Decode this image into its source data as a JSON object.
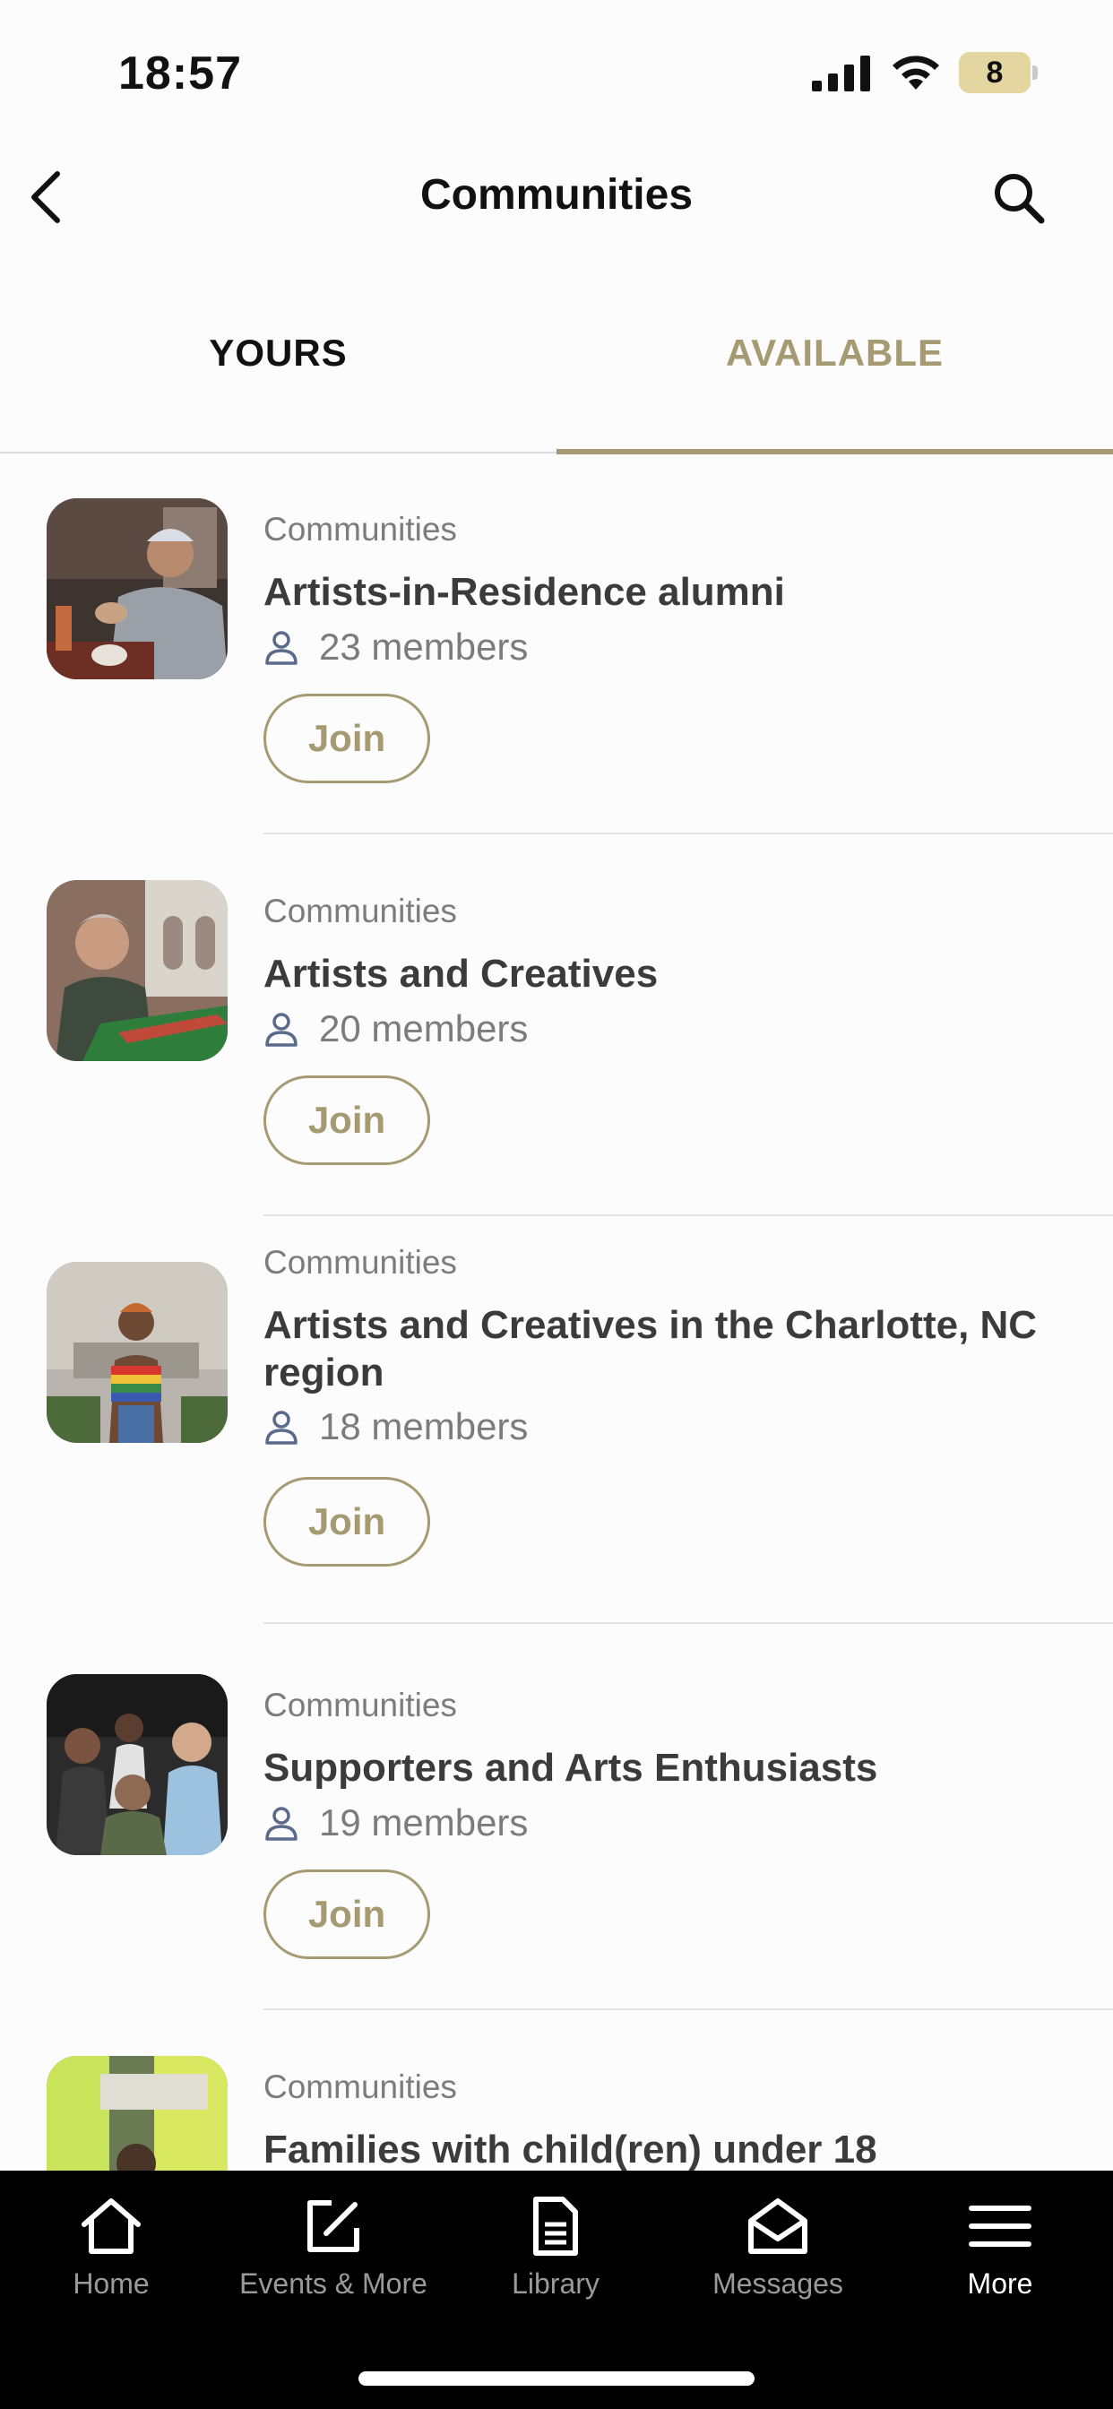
{
  "status_bar": {
    "time": "18:57",
    "battery": "8"
  },
  "header": {
    "title": "Communities"
  },
  "tabs": [
    {
      "label": "YOURS",
      "active": false
    },
    {
      "label": "AVAILABLE",
      "active": true
    }
  ],
  "communities": [
    {
      "category": "Communities",
      "name": "Artists-in-Residence alumni",
      "members": "23 members",
      "join_label": "Join"
    },
    {
      "category": "Communities",
      "name": "Artists and Creatives",
      "members": "20 members",
      "join_label": "Join"
    },
    {
      "category": "Communities",
      "name": "Artists and Creatives in the Charlotte, NC region",
      "members": "18 members",
      "join_label": "Join"
    },
    {
      "category": "Communities",
      "name": "Supporters and Arts Enthusiasts",
      "members": "19 members",
      "join_label": "Join"
    },
    {
      "category": "Communities",
      "name": "Families with child(ren) under 18"
    }
  ],
  "bottom_nav": [
    {
      "label": "Home",
      "icon": "home-icon"
    },
    {
      "label": "Events & More",
      "icon": "edit-icon"
    },
    {
      "label": "Library",
      "icon": "document-icon"
    },
    {
      "label": "Messages",
      "icon": "envelope-icon"
    },
    {
      "label": "More",
      "icon": "menu-icon",
      "active": true
    }
  ],
  "colors": {
    "accent": "#a59a72",
    "text": "#3b3b3b",
    "muted": "#7c7c7c",
    "tabbar": "#000000"
  }
}
